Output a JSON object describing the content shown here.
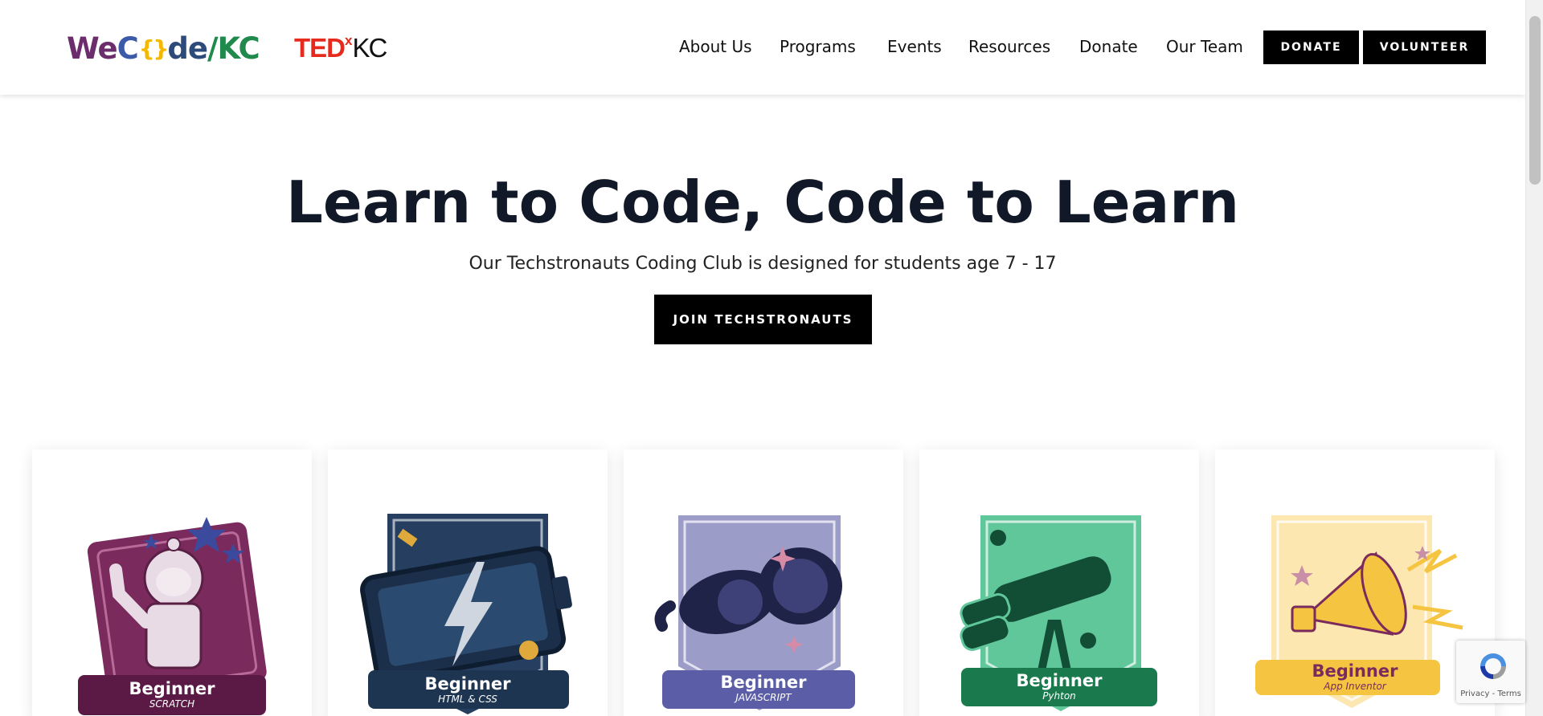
{
  "header": {
    "logo_parts": [
      "We",
      "C",
      "{ }",
      "de",
      "/",
      "KC"
    ],
    "tedx": {
      "ted": "TED",
      "x": "x",
      "kc": "KC"
    },
    "nav": [
      "About Us",
      "Programs",
      "Events",
      "Resources",
      "Donate",
      "Our Team"
    ],
    "donate_button": "DONATE",
    "volunteer_button": "VOLUNTEER"
  },
  "hero": {
    "title": "Learn to Code, Code to Learn",
    "subtitle": "Our Techstronauts Coding Club is designed for students age 7 - 17",
    "cta": "JOIN TECHSTRONAUTS"
  },
  "cards": [
    {
      "level": "Beginner",
      "language": "SCRATCH",
      "icon": "astronaut-icon",
      "color": "#7a2a5c"
    },
    {
      "level": "Beginner",
      "language": "HTML & CSS",
      "icon": "battery-lightning-icon",
      "color": "#263f60"
    },
    {
      "level": "Beginner",
      "language": "JAVASCRIPT",
      "icon": "goggles-icon",
      "color": "#5b5ea6"
    },
    {
      "level": "Beginner",
      "language": "Pyhton",
      "icon": "telescope-icon",
      "color": "#1a7a4e"
    },
    {
      "level": "Beginner",
      "language": "App Inventor",
      "icon": "megaphone-icon",
      "color": "#f5c542"
    }
  ],
  "recaptcha": {
    "text": "Privacy - Terms"
  },
  "colors": {
    "logo_we": "#6b2d6b",
    "logo_c": "#3b5ba9",
    "logo_brace": "#f5b800",
    "logo_de": "#2c4a7a",
    "logo_slash_kc": "#1f8a4c",
    "tedx_red": "#e62b1e",
    "button_black": "#000000"
  }
}
